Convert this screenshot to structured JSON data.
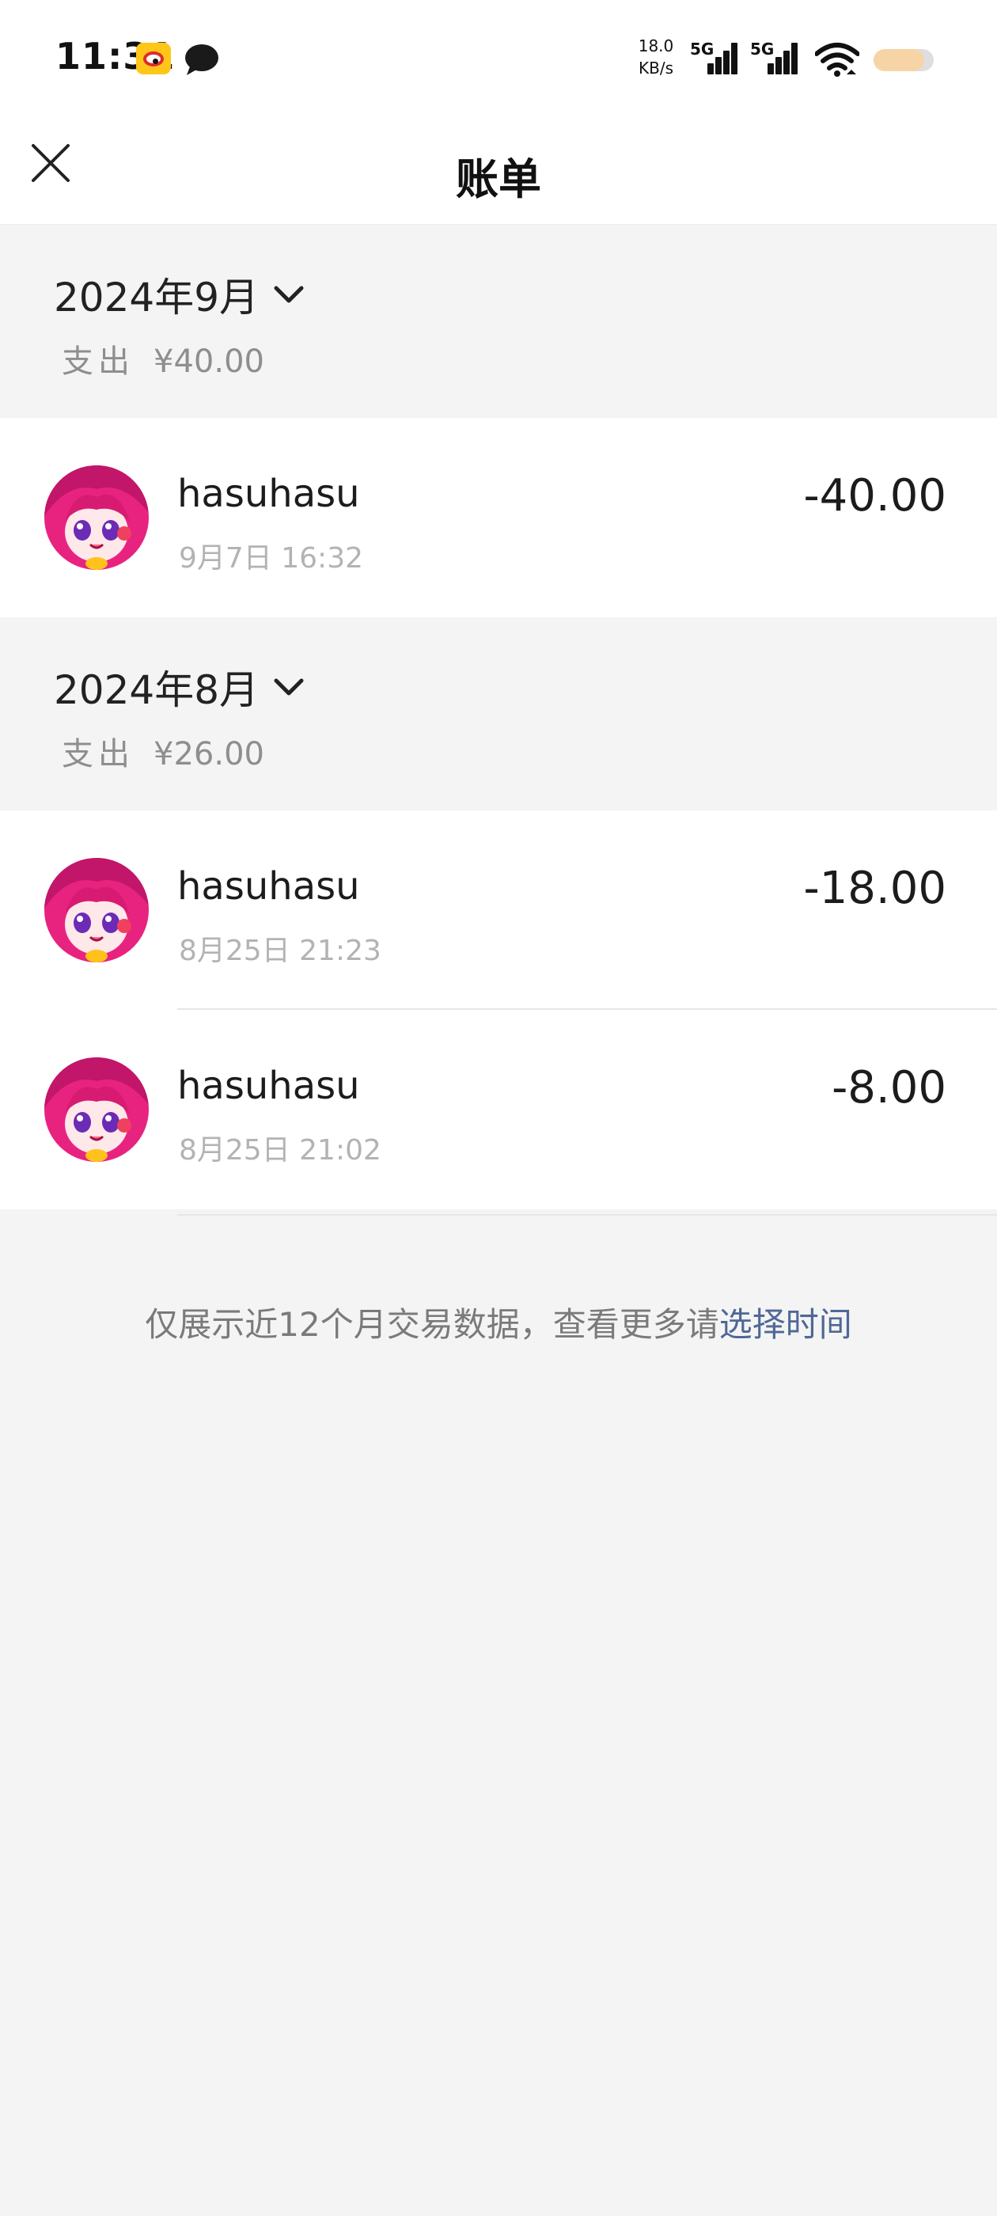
{
  "status_bar": {
    "time": "11:31",
    "net_speed_value": "18.0",
    "net_speed_unit": "KB/s",
    "sim1_label": "5G",
    "sim2_label": "5G"
  },
  "nav": {
    "title": "账单"
  },
  "months": [
    {
      "label": "2024年9月",
      "summary_label": "支出",
      "summary_value": "¥40.00",
      "transactions": [
        {
          "name": "hasuhasu",
          "time": "9月7日 16:32",
          "amount": "-40.00"
        }
      ]
    },
    {
      "label": "2024年8月",
      "summary_label": "支出",
      "summary_value": "¥26.00",
      "transactions": [
        {
          "name": "hasuhasu",
          "time": "8月25日 21:23",
          "amount": "-18.00"
        },
        {
          "name": "hasuhasu",
          "time": "8月25日 21:02",
          "amount": "-8.00"
        }
      ]
    }
  ],
  "footer": {
    "note": "仅展示近12个月交易数据，查看更多请",
    "link": "选择时间"
  },
  "colors": {
    "link": "#4f6896",
    "background": "#f4f4f4",
    "avatar_primary": "#e8237f"
  }
}
